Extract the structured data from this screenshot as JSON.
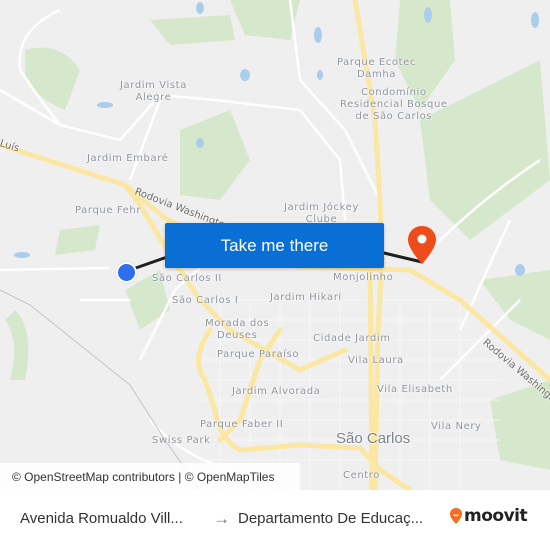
{
  "map": {
    "places": [
      {
        "name": "Jardim Vista\nAlegre",
        "id": "jardim-vista-alegre"
      },
      {
        "name": "Jardim Embaré",
        "id": "jardim-embare"
      },
      {
        "name": "Parque Fehr",
        "id": "parque-fehr"
      },
      {
        "name": "Parque Ecotec\nDamha",
        "id": "parque-ecotec-damha"
      },
      {
        "name": "Condomínio\nResidencial Bosque\nde São Carlos",
        "id": "condominio-bosque"
      },
      {
        "name": "Jardim Jóckey\nClube",
        "id": "jardim-jockey-clube"
      },
      {
        "name": "São Carlos II",
        "id": "sao-carlos-ii"
      },
      {
        "name": "São Carlos I",
        "id": "sao-carlos-i"
      },
      {
        "name": "Monjolinho",
        "id": "monjolinho"
      },
      {
        "name": "Jardim Hikari",
        "id": "jardim-hikari"
      },
      {
        "name": "Morada dos\nDeuses",
        "id": "morada-dos-deuses"
      },
      {
        "name": "Cidade Jardim",
        "id": "cidade-jardim"
      },
      {
        "name": "Parque Paraíso",
        "id": "parque-paraiso"
      },
      {
        "name": "Vila Laura",
        "id": "vila-laura"
      },
      {
        "name": "Jardim Alvorada",
        "id": "jardim-alvorada"
      },
      {
        "name": "Vila Elisabeth",
        "id": "vila-elisabeth"
      },
      {
        "name": "Parque Faber II",
        "id": "parque-faber-ii"
      },
      {
        "name": "Vila Nery",
        "id": "vila-nery"
      },
      {
        "name": "Swiss Park",
        "id": "swiss-park"
      },
      {
        "name": "Centro",
        "id": "centro"
      }
    ],
    "city": "São Carlos",
    "roads": {
      "luis": "Luís",
      "washington_west": "Rodovia Washington L",
      "washington_east": "Rodovia Washington"
    },
    "take_me_there": "Take me there",
    "attribution": "© OpenStreetMap contributors | © OpenMapTiles",
    "colors": {
      "button": "#0a6fd4",
      "origin": "#2e6ef0",
      "destination": "#ee4d1b",
      "route": "#1f1f1f",
      "highway": "#fbe7a1"
    }
  },
  "footer": {
    "origin": "Avenida Romualdo Vill...",
    "arrow": "→",
    "destination": "Departamento De Educaç...",
    "brand": "moovit"
  }
}
